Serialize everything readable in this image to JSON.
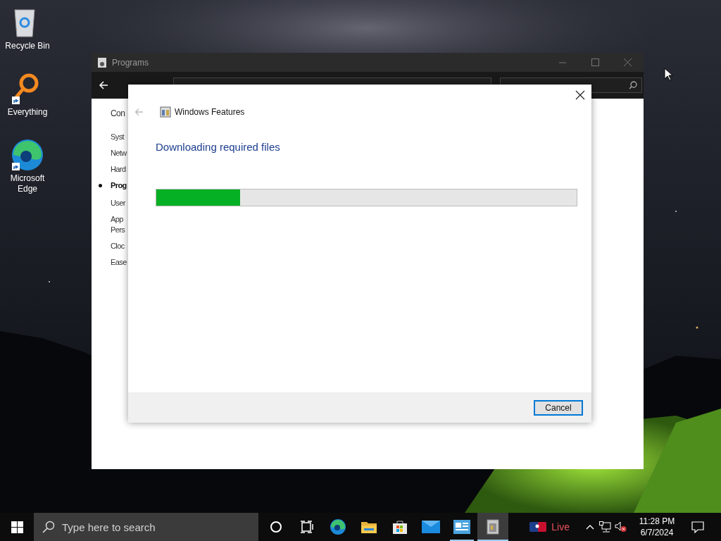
{
  "desktop_icons": [
    {
      "label": "Recycle Bin",
      "kind": "recycle-bin",
      "shortcut": false
    },
    {
      "label": "Everything",
      "kind": "everything",
      "shortcut": true
    },
    {
      "label": "Microsoft Edge",
      "kind": "edge",
      "shortcut": true
    }
  ],
  "programs_window": {
    "title": "Programs",
    "sidebar": [
      {
        "label": "Con",
        "selected": false,
        "kind": "heading"
      },
      {
        "label": "Syst",
        "selected": false,
        "kind": "link"
      },
      {
        "label": "Netw",
        "selected": false,
        "kind": "link"
      },
      {
        "label": "Hard",
        "selected": false,
        "kind": "link"
      },
      {
        "label": "Prog",
        "selected": true,
        "kind": "link"
      },
      {
        "label": "User",
        "selected": false,
        "kind": "link"
      },
      {
        "label": "App\nPers",
        "selected": false,
        "kind": "link"
      },
      {
        "label": "Cloc",
        "selected": false,
        "kind": "link"
      },
      {
        "label": "Ease",
        "selected": false,
        "kind": "link"
      }
    ]
  },
  "dialog": {
    "title": "Windows Features",
    "heading": "Downloading required files",
    "progress": {
      "level": 0.2
    },
    "buttons": [
      "Cancel"
    ]
  },
  "taskbar": {
    "search": {
      "placeholder": "Type here to search"
    },
    "apps": [
      {
        "kind": "cortana",
        "running": false,
        "active": false
      },
      {
        "kind": "task-view",
        "running": false,
        "active": false
      },
      {
        "kind": "edge",
        "running": false,
        "active": false
      },
      {
        "kind": "folder",
        "running": false,
        "active": false
      },
      {
        "kind": "store",
        "running": false,
        "active": false
      },
      {
        "kind": "mail",
        "running": false,
        "active": false
      },
      {
        "kind": "control-panel",
        "running": true,
        "active": false
      },
      {
        "kind": "features",
        "running": true,
        "active": true
      }
    ],
    "news": {
      "label": "Live"
    },
    "clock": {
      "time": "11:28 PM",
      "date": "6/7/2024"
    }
  }
}
